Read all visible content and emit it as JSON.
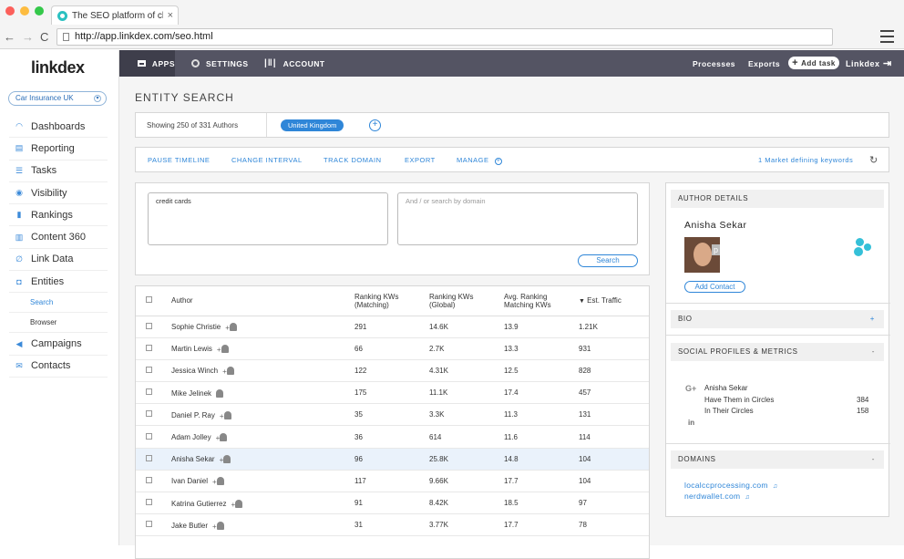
{
  "browser": {
    "tab_title": "The SEO platform of cho",
    "tab_close": "×",
    "url": "http://app.linkdex.com/seo.html",
    "back": "←",
    "forward": "→",
    "reload": "C"
  },
  "sidebar": {
    "logo": "linkdex",
    "project": "Car Insurance UK",
    "items": [
      {
        "label": "Dashboards",
        "icon": "gauge-icon"
      },
      {
        "label": "Reporting",
        "icon": "document-icon"
      },
      {
        "label": "Tasks",
        "icon": "list-icon"
      },
      {
        "label": "Visibility",
        "icon": "eye-icon"
      },
      {
        "label": "Rankings",
        "icon": "bar-chart-icon"
      },
      {
        "label": "Content 360",
        "icon": "book-icon"
      },
      {
        "label": "Link Data",
        "icon": "link-icon"
      },
      {
        "label": "Entities",
        "icon": "entity-icon"
      }
    ],
    "subitems": [
      "Search",
      "Browser"
    ],
    "items2": [
      {
        "label": "Campaigns",
        "icon": "megaphone-icon"
      },
      {
        "label": "Contacts",
        "icon": "envelope-icon"
      }
    ]
  },
  "topnav": {
    "apps": "APPS",
    "settings": "SETTINGS",
    "account": "ACCOUNT",
    "processes": "Processes",
    "exports": "Exports",
    "add_task": "Add task",
    "user": "Linkdex"
  },
  "page": {
    "title": "ENTITY SEARCH",
    "showing": "Showing 250 of 331 Authors",
    "filter_pill": "United Kingdom",
    "actions": [
      "PAUSE TIMELINE",
      "CHANGE INTERVAL",
      "TRACK DOMAIN",
      "EXPORT",
      "MANAGE"
    ],
    "market_keywords": "1 Market defining keywords",
    "search_query": "credit cards",
    "domain_placeholder": "And / or search by domain",
    "search_button": "Search"
  },
  "table": {
    "headers": [
      "Author",
      "Ranking KWs\n(Matching)",
      "Ranking KWs\n(Global)",
      "Avg. Ranking\nMatching KWs",
      "Est. Traffic"
    ],
    "rows": [
      [
        "Sophie Christie",
        "291",
        "14.6K",
        "13.9",
        "1.21K"
      ],
      [
        "Martin Lewis",
        "66",
        "2.7K",
        "13.3",
        "931"
      ],
      [
        "Jessica Winch",
        "122",
        "4.31K",
        "12.5",
        "828"
      ],
      [
        "Mike Jelinek",
        "175",
        "11.1K",
        "17.4",
        "457"
      ],
      [
        "Daniel P. Ray",
        "35",
        "3.3K",
        "11.3",
        "131"
      ],
      [
        "Adam Jolley",
        "36",
        "614",
        "11.6",
        "114"
      ],
      [
        "Anisha Sekar",
        "96",
        "25.8K",
        "14.8",
        "104"
      ],
      [
        "Ivan Daniel",
        "117",
        "9.66K",
        "17.7",
        "104"
      ],
      [
        "Katrina Gutierrez",
        "91",
        "8.42K",
        "18.5",
        "97"
      ],
      [
        "Jake Butler",
        "31",
        "3.77K",
        "17.7",
        "78"
      ]
    ],
    "highlight_index": 6
  },
  "details": {
    "section_author": "AUTHOR DETAILS",
    "name": "Anisha Sekar",
    "add_contact": "Add Contact",
    "section_bio": "BIO",
    "bio_toggle": "+",
    "section_social": "SOCIAL PROFILES & METRICS",
    "social_toggle": "-",
    "gplus_name": "Anisha Sekar",
    "have_them_label": "Have Them in Circles",
    "have_them_value": "384",
    "in_their_label": "In Their Circles",
    "in_their_value": "158",
    "section_domains": "DOMAINS",
    "domains_toggle": "-",
    "domains": [
      "localccprocessing.com",
      "nerdwallet.com"
    ]
  }
}
